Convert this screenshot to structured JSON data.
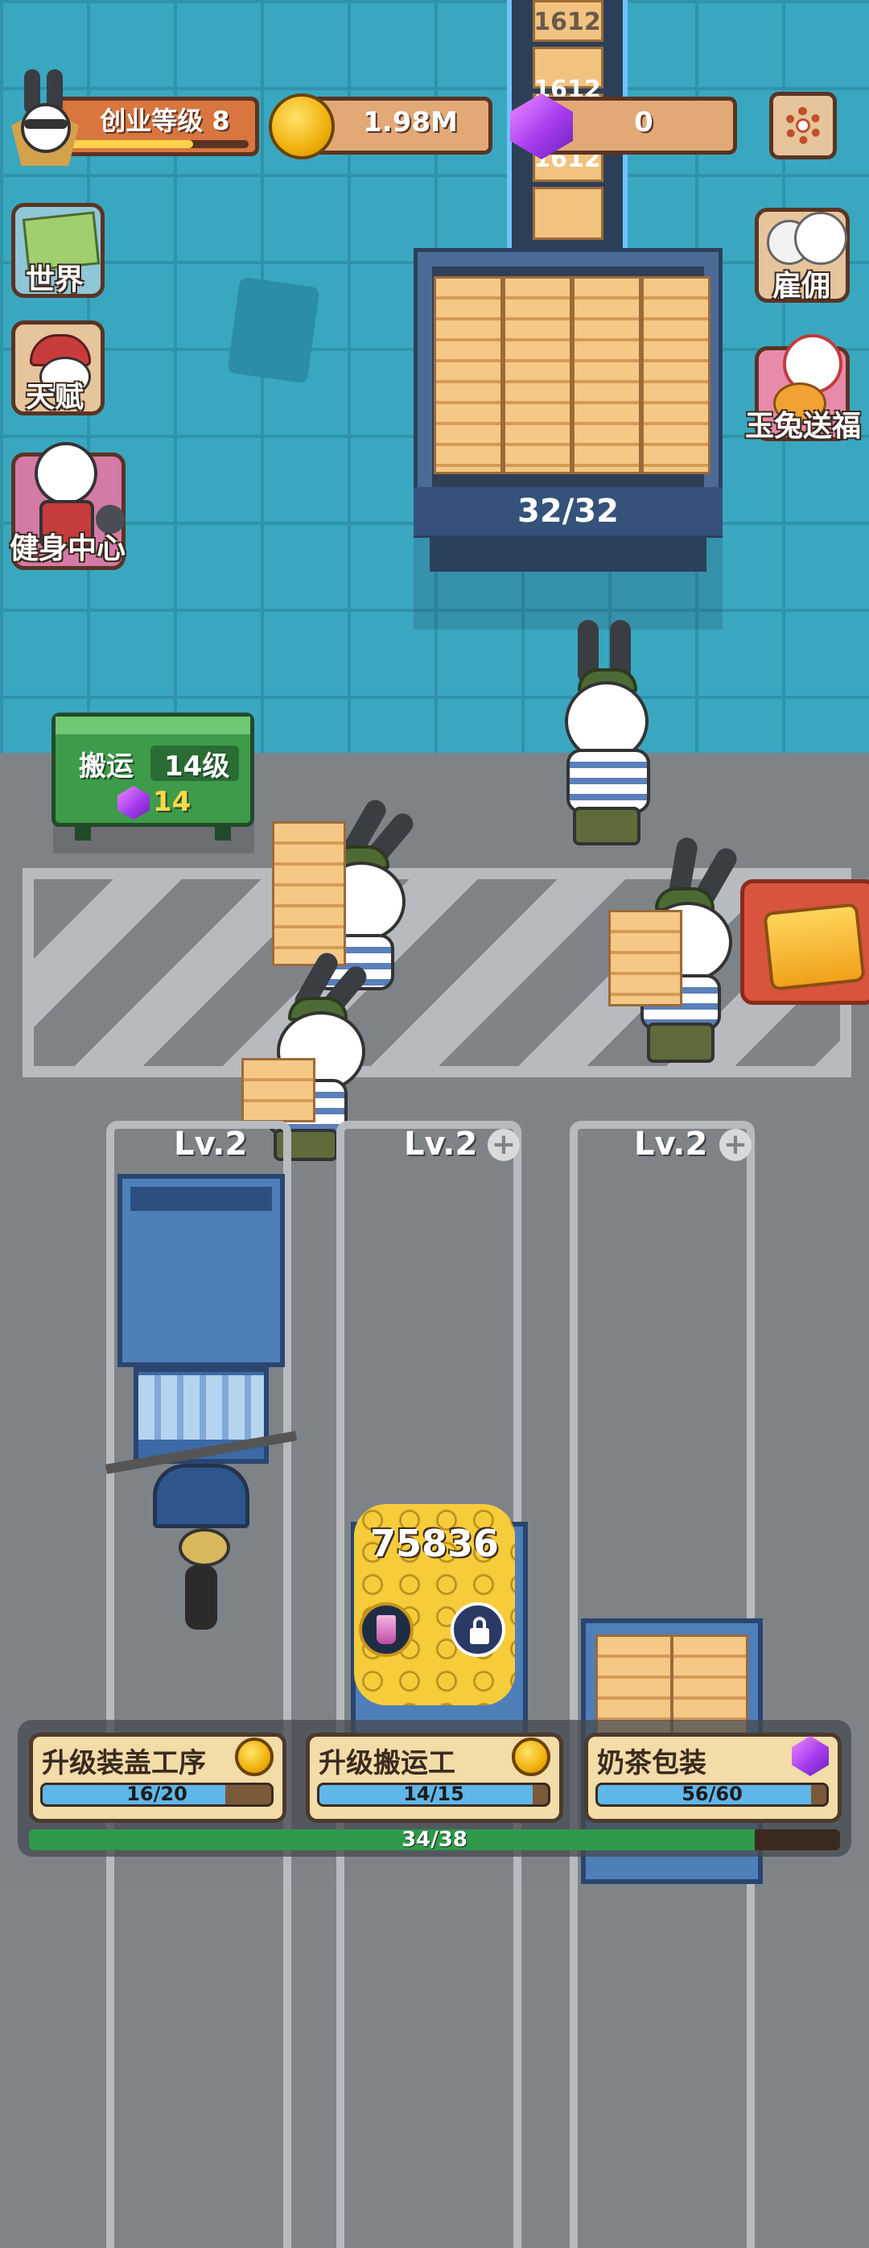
{
  "hud": {
    "level_label": "创业等级 8",
    "level_progress": 0.7,
    "coins": "1.98M",
    "gems": "0"
  },
  "conveyor": {
    "labels": [
      "1612",
      "1612",
      "1612"
    ]
  },
  "storage": {
    "count": "32/32"
  },
  "left_menu": {
    "world": "世界",
    "talent": "天赋",
    "gym": "健身中心"
  },
  "right_menu": {
    "hire": "雇佣",
    "rabbit_gift": "玉兔送福"
  },
  "carry_station": {
    "title": "搬运",
    "level": "14级",
    "gem_cost": "14"
  },
  "lanes": [
    {
      "level": "Lv.2"
    },
    {
      "level": "Lv.2"
    },
    {
      "level": "Lv.2"
    }
  ],
  "coin_pile": {
    "amount": "75836"
  },
  "upgrades": [
    {
      "title": "升级装盖工序",
      "progress": "16/20",
      "ratio": 0.8,
      "icon": "coin-icon"
    },
    {
      "title": "升级搬运工",
      "progress": "14/15",
      "ratio": 0.933,
      "icon": "coin-icon"
    },
    {
      "title": "奶茶包装",
      "progress": "56/60",
      "ratio": 0.933,
      "icon": "gem-icon"
    }
  ],
  "overall_progress": {
    "text": "34/38",
    "ratio": 0.895
  },
  "colors": {
    "floor": "#3aa7c1",
    "road": "#7e8388",
    "accent_green": "#2e9a4a",
    "progress_blue": "#5fb6e8"
  }
}
